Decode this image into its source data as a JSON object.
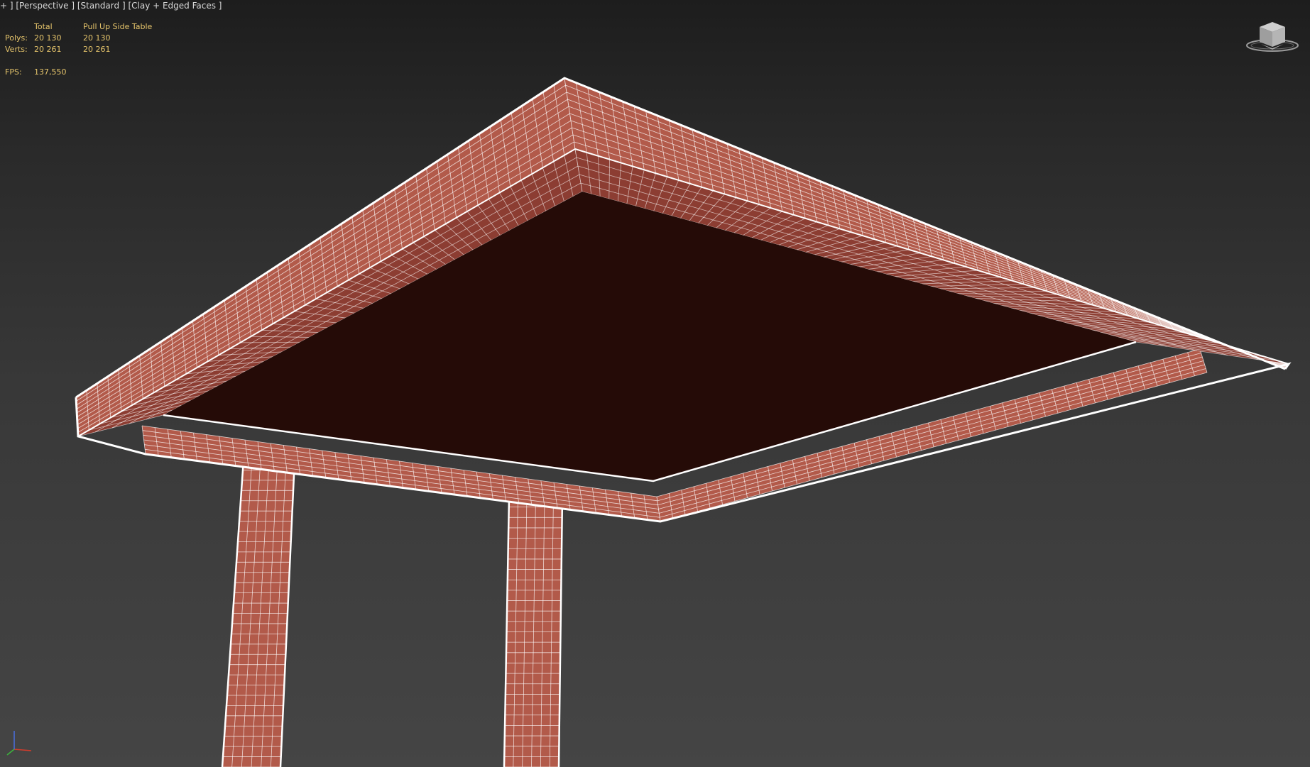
{
  "viewport": {
    "label": "+ ] [Perspective ] [Standard ] [Clay + Edged Faces ]",
    "colors": {
      "background_top": "#1d1d1d",
      "background_bottom": "#454545",
      "clay": "#b25a4a",
      "clay_dark": "#8c3d32",
      "underside": "#250b07",
      "wire": "#ffffff",
      "stats_text": "#e5c46b"
    }
  },
  "stats": {
    "header_total": "Total",
    "header_object": "Pull Up Side Table",
    "polys_label": "Polys:",
    "polys_total": "20 130",
    "polys_object": "20 130",
    "verts_label": "Verts:",
    "verts_total": "20 261",
    "verts_object": "20 261",
    "fps_label": "FPS:",
    "fps_value": "137,550"
  },
  "viewcube": {
    "icon": "viewcube-icon"
  },
  "axis": {
    "icon": "axis-tripod-icon",
    "x_color": "#d23c2c",
    "y_color": "#3cb43c",
    "z_color": "#4a6ee0"
  },
  "model": {
    "name": "Pull Up Side Table",
    "display_mode": "Clay + Edged Faces"
  }
}
